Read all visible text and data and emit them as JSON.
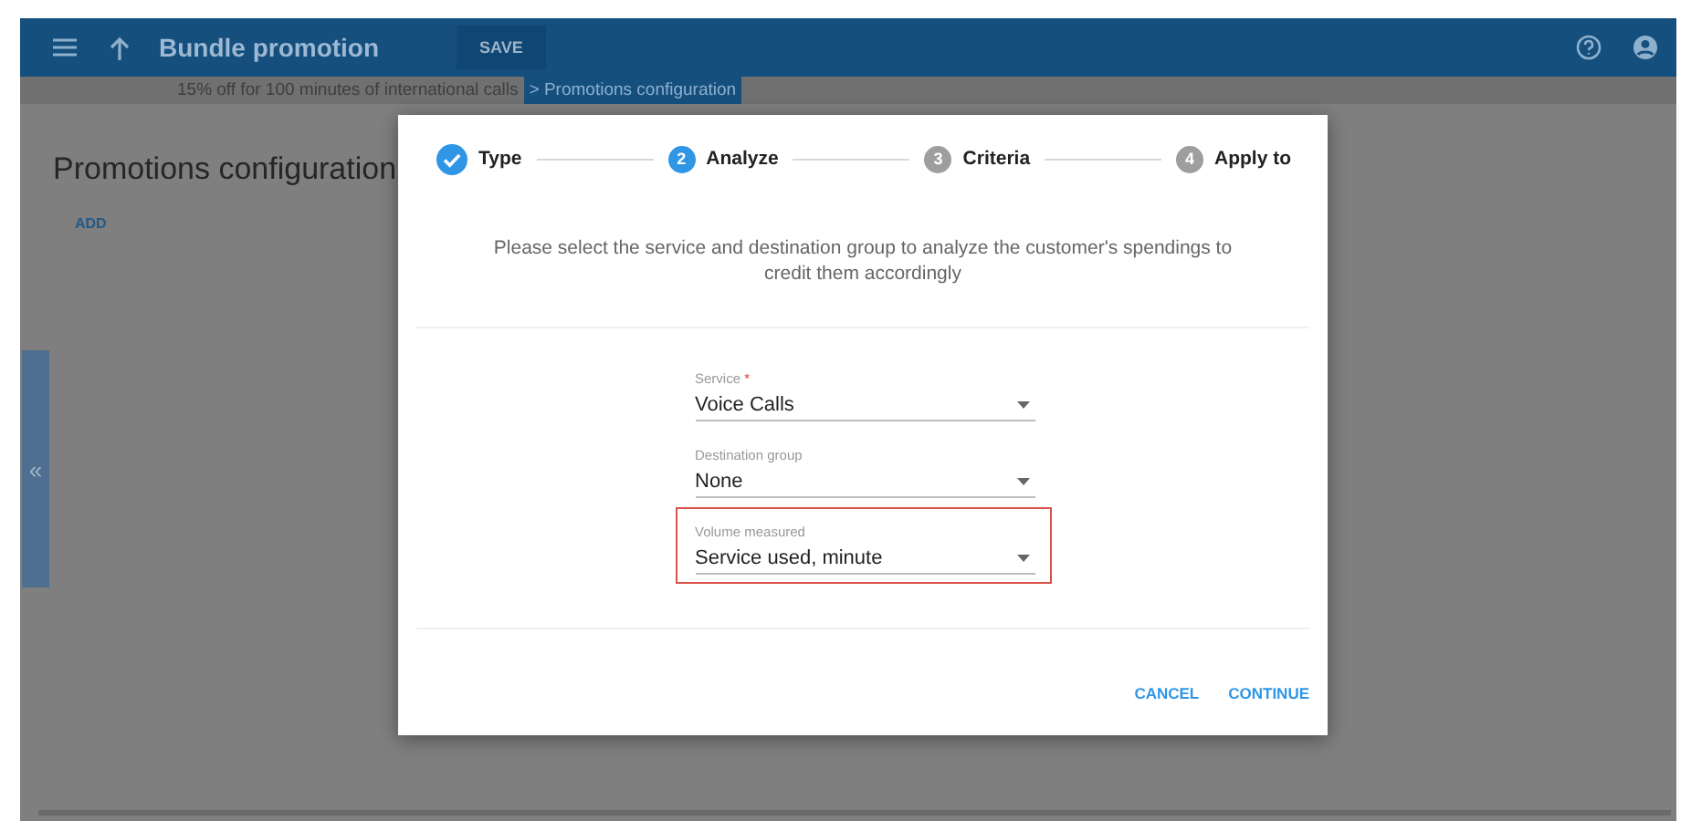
{
  "header": {
    "title": "Bundle promotion",
    "save_button": "SAVE"
  },
  "breadcrumbs": [
    {
      "label": "15% off for 100 minutes of international calls",
      "selected": false
    },
    {
      "label": "> Promotions configuration",
      "selected": true
    }
  ],
  "page": {
    "title": "Promotions configuration",
    "add_button": "ADD",
    "side_toggle": "«"
  },
  "dialog": {
    "steps": [
      {
        "label": "Type",
        "done": true,
        "selected": false
      },
      {
        "number": "2",
        "label": "Analyze",
        "done": false,
        "selected": true
      },
      {
        "number": "3",
        "label": "Criteria",
        "done": false,
        "selected": false
      },
      {
        "number": "4",
        "label": "Apply to",
        "done": false,
        "selected": false
      }
    ],
    "description": "Please select the service and destination group to analyze the customer's spendings to credit them accordingly",
    "fields": [
      {
        "label": "Service",
        "required_mark": "*",
        "value": "Voice Calls",
        "highlighted": false
      },
      {
        "label": "Destination group",
        "value": "None",
        "highlighted": false
      },
      {
        "label": "Volume measured",
        "value": "Service used, minute",
        "highlighted": true
      }
    ],
    "buttons": [
      "CANCEL",
      "CONTINUE"
    ]
  }
}
